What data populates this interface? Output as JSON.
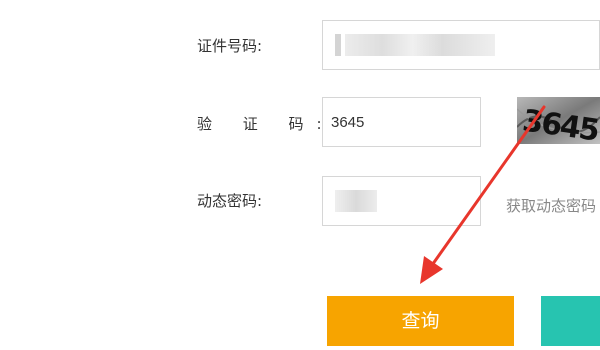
{
  "form": {
    "id_label": "证件号码:",
    "captcha_label": "验 证 码:",
    "captcha_value": "3645",
    "captcha_image_text": "3645",
    "dynamic_label": "动态密码:",
    "get_dynamic_link": "获取动态密码"
  },
  "buttons": {
    "query_label": "查询",
    "secondary_label": ""
  },
  "colors": {
    "query_button": "#f7a400",
    "secondary_button": "#27c4b0",
    "annotation_arrow": "#e8362c"
  }
}
